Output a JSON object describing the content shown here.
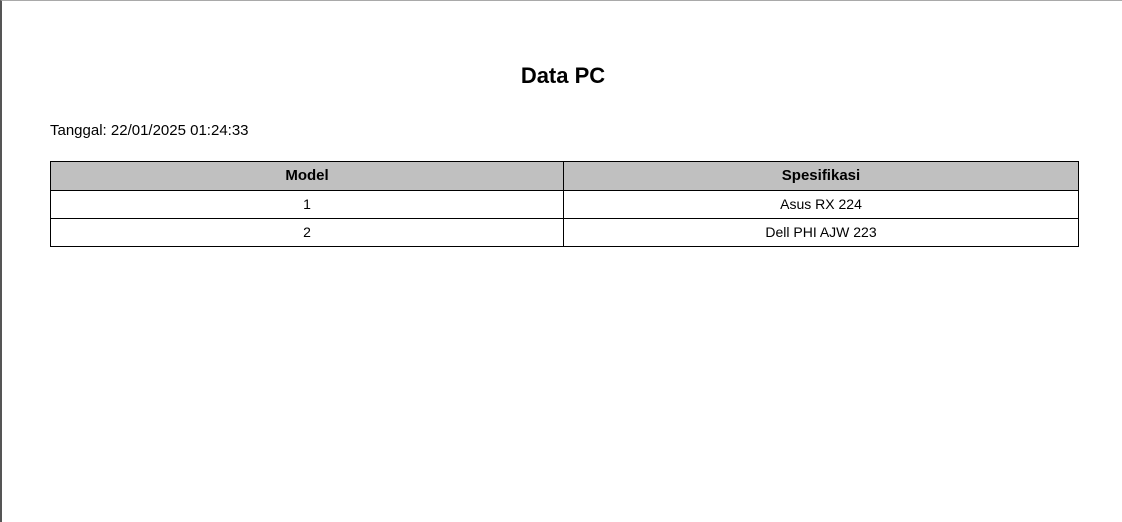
{
  "document": {
    "title": "Data PC",
    "date_label": "Tanggal: 22/01/2025 01:24:33"
  },
  "table": {
    "headers": [
      "Model",
      "Spesifikasi"
    ],
    "rows": [
      [
        "1",
        "Asus RX 224"
      ],
      [
        "2",
        "Dell PHI AJW 223"
      ]
    ],
    "header_bg": "#c0c0c0",
    "border_color": "#000000"
  }
}
